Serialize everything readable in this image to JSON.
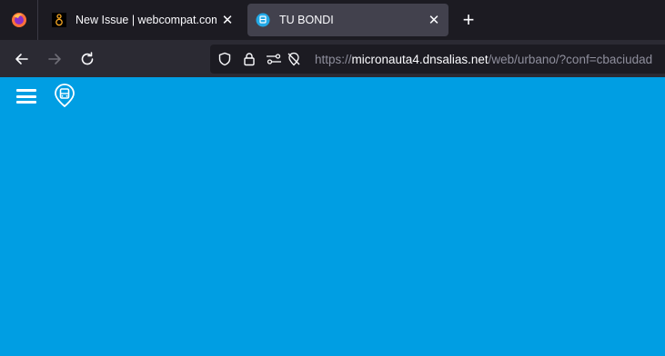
{
  "browser": {
    "tabs": [
      {
        "label": "New Issue | webcompat.com",
        "favicon": "webcompat-icon",
        "active": false
      },
      {
        "label": "TU BONDI",
        "favicon": "tubondi-icon",
        "active": true
      }
    ],
    "close_glyph": "✕",
    "newtab_glyph": "+",
    "url": {
      "scheme": "https://",
      "host": "micronauta4.dnsalias.net",
      "path": "/web/urbano/?conf=cbaciudad"
    }
  },
  "page": {
    "background": "#009ee3",
    "menu_icon": "hamburger-menu-icon",
    "logo_icon": "bus-stop-icon"
  }
}
